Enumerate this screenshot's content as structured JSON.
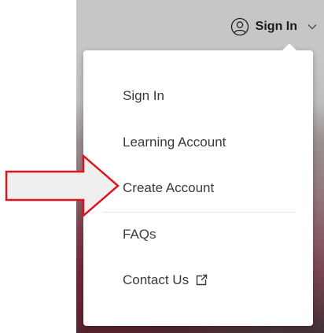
{
  "header": {
    "signin_label": "Sign In",
    "user_icon": "user-circle-icon",
    "chevron_icon": "chevron-down-icon"
  },
  "menu": {
    "items": [
      {
        "label": "Sign In"
      },
      {
        "label": "Learning Account"
      },
      {
        "label": "Create Account"
      },
      {
        "label": "FAQs"
      },
      {
        "label": "Contact Us",
        "icon": "external-link-icon"
      }
    ]
  },
  "annotation": {
    "arrow_color": "#e0141e",
    "arrow_fill": "#efefef"
  }
}
